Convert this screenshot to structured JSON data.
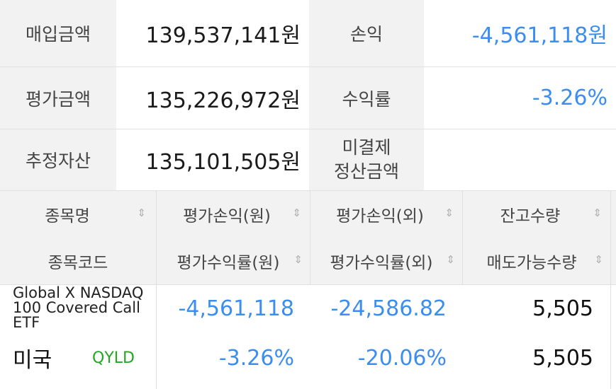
{
  "summary": {
    "purchase_label": "매입금액",
    "purchase_value": "139,537,141원",
    "pnl_label": "손익",
    "pnl_value": "-4,561,118원",
    "eval_label": "평가금액",
    "eval_value": "135,226,972원",
    "return_label": "수익률",
    "return_value": "-3.26%",
    "estimated_label": "추정자산",
    "estimated_value": "135,101,505원",
    "unsettled_label_line1": "미결제",
    "unsettled_label_line2": "정산금액",
    "unsettled_value": ""
  },
  "table": {
    "headers_row1": [
      "종목명",
      "평가손익(원)",
      "평가손익(외)",
      "잔고수량"
    ],
    "headers_row2": [
      "종목코드",
      "평가수익률(원)",
      "평가수익률(외)",
      "매도가능수량"
    ],
    "sort_icon": "⇕",
    "rows": [
      {
        "name": "Global X NASDAQ 100 Covered Call ETF",
        "market": "미국",
        "code": "QYLD",
        "pnl_krw": "-4,561,118",
        "pnl_foreign": "-24,586.82",
        "qty": "5,505",
        "return_krw": "-3.26%",
        "return_foreign": "-20.06%",
        "sellable_qty": "5,505"
      }
    ]
  },
  "colors": {
    "negative": "#3b8ef0",
    "ticker": "#22a822",
    "label_bg": "#f2f2f2"
  }
}
